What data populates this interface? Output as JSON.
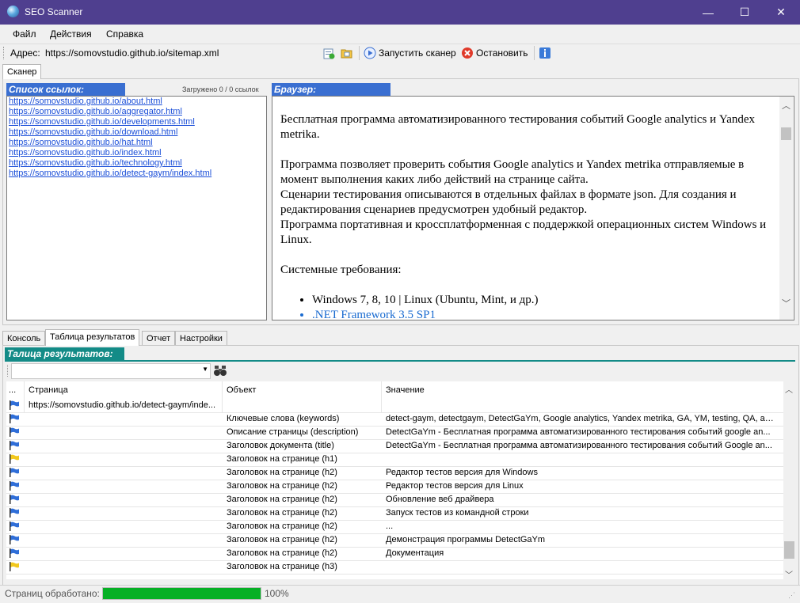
{
  "window": {
    "title": "SEO Scanner",
    "minimize": "—",
    "maximize": "☐",
    "close": "✕"
  },
  "menu": [
    "Файл",
    "Действия",
    "Справка"
  ],
  "address": {
    "label": "Адрес:",
    "value": "https://somovstudio.github.io/sitemap.xml",
    "run_label": "Запустить сканер",
    "stop_label": "Остановить"
  },
  "top_tab": "Сканер",
  "links_panel": {
    "title": "Список ссылок:",
    "loaded": "Загружено 0 / 0 ссылок",
    "links": [
      "https://somovstudio.github.io/about.html",
      "https://somovstudio.github.io/aggregator.html",
      "https://somovstudio.github.io/developments.html",
      "https://somovstudio.github.io/download.html",
      "https://somovstudio.github.io/hat.html",
      "https://somovstudio.github.io/index.html",
      "https://somovstudio.github.io/technology.html",
      "https://somovstudio.github.io/detect-gaym/index.html"
    ]
  },
  "browser": {
    "title": "Браузер:",
    "p1": "Бесплатная программа автоматизированного тестирования событий Google analytics и Yandex metrika.",
    "p2a": "Программа позволяет проверить события Google analytics и Yandex metrika отправляемые в момент выполнения каких либо действий на странице сайта.",
    "p2b": "Сценарии тестирования описываются в отдельных файлах в формате json. Для создания и редактирования сценариев предусмотрен удобный редактор.",
    "p2c": "Программа портативная и кроссплатформенная с поддержкой операционных систем Windows и Linux.",
    "req_title": "Системные требования:",
    "req_items": [
      "Windows 7, 8, 10 | Linux (Ubuntu, Mint, и др.)",
      ".NET Framework 3.5 SP1"
    ]
  },
  "bottom_tabs": [
    "Консоль",
    "Таблица результатов",
    "Отчет",
    "Настройки"
  ],
  "results": {
    "title": "Талица результатов:",
    "columns": [
      "...",
      "Страница",
      "Объект",
      "Значение"
    ],
    "rows": [
      {
        "flag": "blue",
        "page": "https://somovstudio.github.io/detect-gaym/inde...",
        "object": "",
        "value": ""
      },
      {
        "flag": "blue",
        "page": "",
        "object": "Ключевые слова (keywords)",
        "value": "detect-gaym, detectgaym, DetectGaYm, Google analytics, Yandex metrika, GA, YM, testing, QA, авто..."
      },
      {
        "flag": "blue",
        "page": "",
        "object": "Описание страницы (description)",
        "value": "DetectGaYm - Бесплатная программа автоматизированного тестирования событий google an..."
      },
      {
        "flag": "blue",
        "page": "",
        "object": "Заголовок документа (title)",
        "value": "DetectGaYm - Бесплатная программа автоматизированного тестирования событий Google an..."
      },
      {
        "flag": "yellow",
        "page": "",
        "object": "Заголовок на странице (h1)",
        "value": ""
      },
      {
        "flag": "blue",
        "page": "",
        "object": "Заголовок на странице (h2)",
        "value": "Редактор тестов версия для Windows"
      },
      {
        "flag": "blue",
        "page": "",
        "object": "Заголовок на странице (h2)",
        "value": "Редактор тестов версия для Linux"
      },
      {
        "flag": "blue",
        "page": "",
        "object": "Заголовок на странице (h2)",
        "value": "Обновление веб драйвера"
      },
      {
        "flag": "blue",
        "page": "",
        "object": "Заголовок на странице (h2)",
        "value": "Запуск тестов из командной строки"
      },
      {
        "flag": "blue",
        "page": "",
        "object": "Заголовок на странице (h2)",
        "value": "..."
      },
      {
        "flag": "blue",
        "page": "",
        "object": "Заголовок на странице (h2)",
        "value": "Демонстрация программы DetectGaYm"
      },
      {
        "flag": "blue",
        "page": "",
        "object": "Заголовок на странице (h2)",
        "value": "Документация"
      },
      {
        "flag": "yellow",
        "page": "",
        "object": "Заголовок на странице (h3)",
        "value": ""
      }
    ]
  },
  "status": {
    "label": "Страниц обработано:",
    "percent_text": "100%",
    "progress": 1.0
  },
  "colors": {
    "title_bar": "#4f3f8f",
    "panel_head_blue": "#3a6fd1",
    "panel_head_teal": "#138b87",
    "progress": "#06b025",
    "link": "#1a4ed8"
  }
}
